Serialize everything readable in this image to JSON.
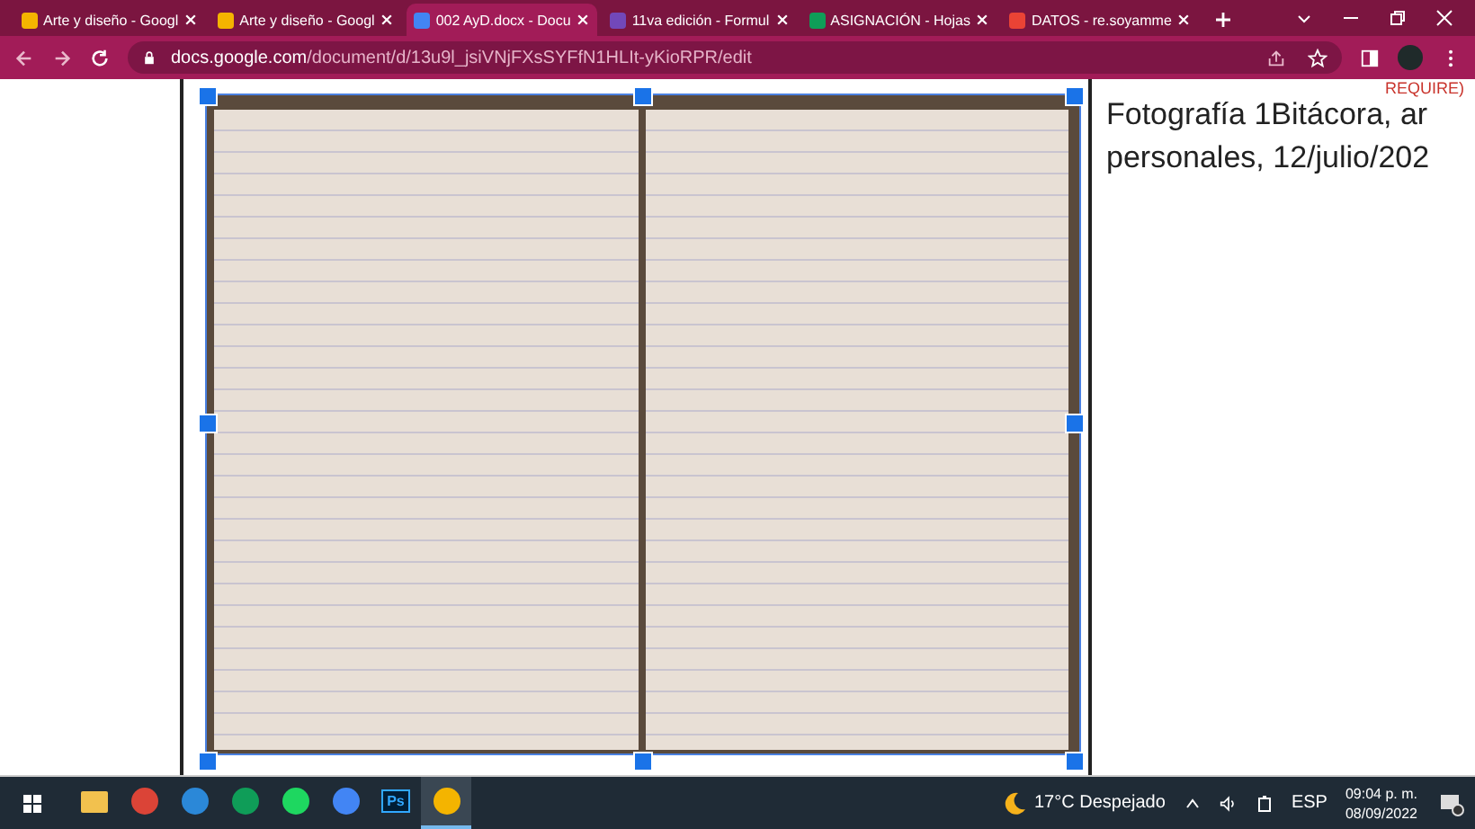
{
  "tabs": [
    {
      "title": "Arte y diseño - Googl",
      "kind": "drive",
      "selected": false
    },
    {
      "title": "Arte y diseño - Googl",
      "kind": "drive",
      "selected": false
    },
    {
      "title": "002 AyD.docx - Docu",
      "kind": "docs",
      "selected": true
    },
    {
      "title": "11va edición - Formul",
      "kind": "forms",
      "selected": false
    },
    {
      "title": "ASIGNACIÓN - Hojas",
      "kind": "sheets",
      "selected": false
    },
    {
      "title": "DATOS - re.soyamme",
      "kind": "gmail",
      "selected": false
    }
  ],
  "address_bar": {
    "host": "docs.google.com",
    "path": "/document/d/13u9l_jsiVNjFXsSYFfN1HLIt-yKioRPR/edit"
  },
  "document": {
    "header_fragment": "REQUIRE)",
    "caption_lines": [
      "Fotografía 1Bitácora, ar",
      "personales, 12/julio/202"
    ]
  },
  "taskbar": {
    "apps": [
      {
        "kind": "folder",
        "active": false
      },
      {
        "kind": "chrome-alt",
        "active": false
      },
      {
        "kind": "edge",
        "active": false
      },
      {
        "kind": "chrome",
        "active": false
      },
      {
        "kind": "spotify",
        "active": false
      },
      {
        "kind": "chrome-badge",
        "active": false
      },
      {
        "kind": "photoshop",
        "label": "Ps",
        "active": false
      },
      {
        "kind": "chrome-dark",
        "active": true
      }
    ],
    "weather": "17°C  Despejado",
    "language": "ESP",
    "time": "09:04 p. m.",
    "date": "08/09/2022"
  }
}
